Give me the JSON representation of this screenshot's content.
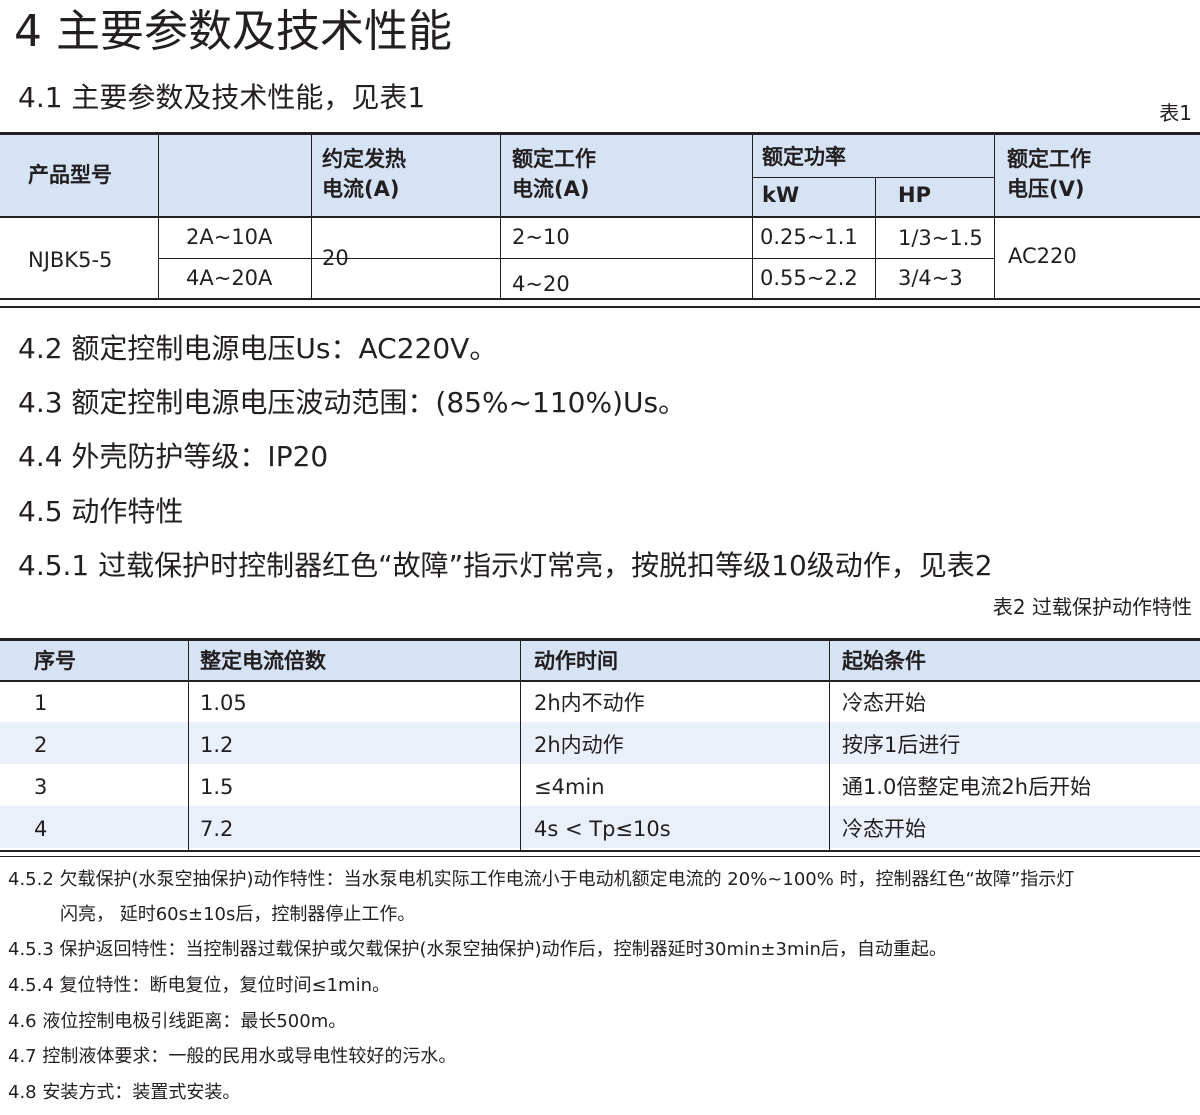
{
  "heading": "4 主要参数及技术性能",
  "subheading": "4.1 主要参数及技术性能，见表1",
  "table1": {
    "caption": "表1",
    "headers": {
      "model": "产品型号",
      "current_setting_col": "",
      "thermal_line1": "约定发热",
      "thermal_line2": "电流(A)",
      "work_current_line1": "额定工作",
      "work_current_line2": "电流(A)",
      "power": "额定功率",
      "power_kw": "kW",
      "power_hp": "HP",
      "voltage_line1": "额定工作",
      "voltage_line2": "电压(V)"
    },
    "model": "NJBK5-5",
    "thermal_current": "20",
    "voltage": "AC220",
    "rows": [
      {
        "range": "2A~10A",
        "work_current": "2~10",
        "kw": "0.25~1.1",
        "hp": "1/3~1.5"
      },
      {
        "range": "4A~20A",
        "work_current": "4~20",
        "kw": "0.55~2.2",
        "hp": "3/4~3"
      }
    ]
  },
  "sections": {
    "s42": "4.2 额定控制电源电压Us：AC220V。",
    "s43": "4.3 额定控制电源电压波动范围：(85%~110%)Us。",
    "s44": "4.4 外壳防护等级：IP20",
    "s45": "4.5 动作特性",
    "s451": "4.5.1 过载保护时控制器红色“故障”指示灯常亮，按脱扣等级10级动作，见表2"
  },
  "table2": {
    "caption": "表2 过载保护动作特性",
    "headers": [
      "序号",
      "整定电流倍数",
      "动作时间",
      "起始条件"
    ],
    "rows": [
      [
        "1",
        "1.05",
        "2h内不动作",
        "冷态开始"
      ],
      [
        "2",
        "1.2",
        "2h内动作",
        "按序1后进行"
      ],
      [
        "3",
        "1.5",
        "≤4min",
        "通1.0倍整定电流2h后开始"
      ],
      [
        "4",
        "7.2",
        "4s < Tp≤10s",
        "冷态开始"
      ]
    ]
  },
  "notes": {
    "n452_line1": "4.5.2 欠载保护(水泵空抽保护)动作特性：当水泵电机实际工作电流小于电动机额定电流的 20%~100% 时，控制器红色“故障”指示灯",
    "n452_line2": "闪亮， 延时60s±10s后，控制器停止工作。",
    "n453": "4.5.3 保护返回特性：当控制器过载保护或欠载保护(水泵空抽保护)动作后，控制器延时30min±3min后，自动重起。",
    "n454": "4.5.4 复位特性：断电复位，复位时间≤1min。",
    "n46": "4.6 液位控制电极引线距离：最长500m。",
    "n47": "4.7 控制液体要求：一般的民用水或导电性较好的污水。",
    "n48": "4.8 安装方式：装置式安装。"
  }
}
